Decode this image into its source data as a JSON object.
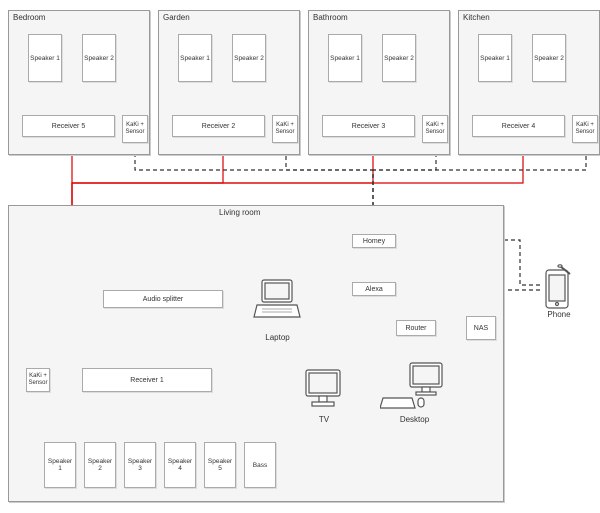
{
  "rooms": {
    "bedroom": {
      "title": "Bedroom",
      "speakers": [
        "Speaker 1",
        "Speaker 2"
      ],
      "receiver": "Receiver 5",
      "sensor": "KaKi + Sensor"
    },
    "garden": {
      "title": "Garden",
      "speakers": [
        "Speaker 1",
        "Speaker 2"
      ],
      "receiver": "Receiver 2",
      "sensor": "KaKi + Sensor"
    },
    "bathroom": {
      "title": "Bathroom",
      "speakers": [
        "Speaker 1",
        "Speaker 2"
      ],
      "receiver": "Receiver 3",
      "sensor": "KaKi + Sensor"
    },
    "kitchen": {
      "title": "Kitchen",
      "speakers": [
        "Speaker 1",
        "Speaker 2"
      ],
      "receiver": "Receiver 4",
      "sensor": "KaKi + Sensor"
    }
  },
  "living": {
    "title": "Living room",
    "splitter": "Audio splitter",
    "receiver": "Receiver 1",
    "sensor": "KaKi + Sensor",
    "speakers": [
      "Speaker 1",
      "Speaker 2",
      "Speaker 3",
      "Speaker 4",
      "Speaker 5",
      "Bass"
    ],
    "homey": "Homey",
    "alexa": "Alexa",
    "router": "Router",
    "laptop": "Laptop",
    "tv": "TV",
    "desktop": "Desktop",
    "nas": "NAS",
    "phone": "Phone"
  }
}
